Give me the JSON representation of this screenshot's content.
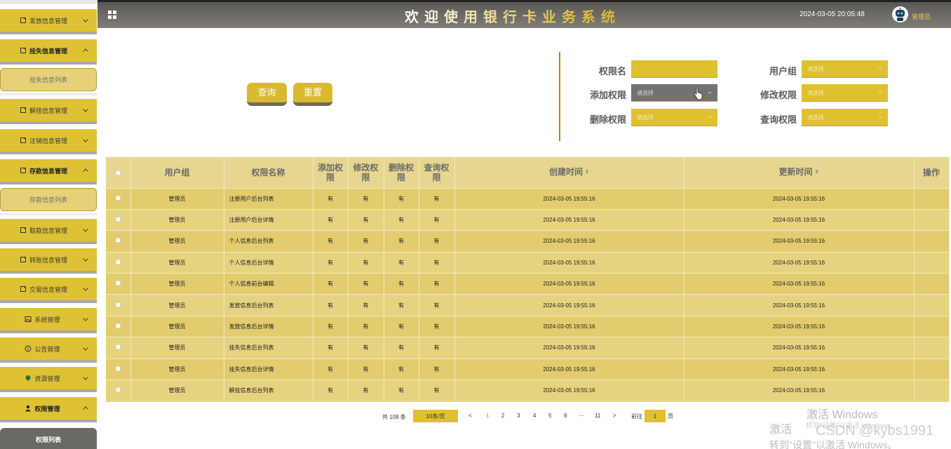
{
  "header": {
    "title": "欢迎使用银行卡业务系统",
    "datetime": "2024-03-05 20:05:48",
    "user": "管理员"
  },
  "sidebar": {
    "items": [
      {
        "label": "发放信息管理",
        "icon": "doc-icon",
        "expanded": false
      },
      {
        "label": "挂失信息管理",
        "icon": "doc-icon",
        "expanded": true,
        "sub": "挂失信息列表"
      },
      {
        "label": "解挂信息管理",
        "icon": "doc-icon",
        "expanded": false
      },
      {
        "label": "注销信息管理",
        "icon": "doc-icon",
        "expanded": false
      },
      {
        "label": "存款信息管理",
        "icon": "doc-icon",
        "expanded": true,
        "sub": "存款信息列表"
      },
      {
        "label": "取款信息管理",
        "icon": "doc-icon",
        "expanded": false
      },
      {
        "label": "转账信息管理",
        "icon": "doc-icon",
        "expanded": false
      },
      {
        "label": "交易信息管理",
        "icon": "doc-icon",
        "expanded": false
      },
      {
        "label": "系统管理",
        "icon": "image-icon",
        "expanded": false
      },
      {
        "label": "公告管理",
        "icon": "info-icon",
        "expanded": false
      },
      {
        "label": "资源管理",
        "icon": "leaf-icon",
        "expanded": false
      },
      {
        "label": "权限管理",
        "icon": "user-icon",
        "expanded": true,
        "sub": "权限列表"
      }
    ]
  },
  "search": {
    "query_label": "查询",
    "reset_label": "重置",
    "fields": {
      "perm_name": {
        "label": "权限名",
        "value": ""
      },
      "user_group": {
        "label": "用户组",
        "placeholder": "请选择"
      },
      "add_perm": {
        "label": "添加权限",
        "placeholder": "请选择"
      },
      "edit_perm": {
        "label": "修改权限",
        "placeholder": "请选择"
      },
      "delete_perm": {
        "label": "删除权限",
        "placeholder": "请选择"
      },
      "query_perm": {
        "label": "查询权限",
        "placeholder": "请选择"
      }
    }
  },
  "table": {
    "headers": {
      "group": "用户组",
      "name": "权限名称",
      "add_1": "添加权",
      "add_2": "限",
      "edit_1": "修改权",
      "edit_2": "限",
      "del_1": "删除权",
      "del_2": "限",
      "query_1": "查询权",
      "query_2": "限",
      "created": "创建时间",
      "updated": "更新时间",
      "ops": "操作"
    },
    "rows": [
      [
        "管理员",
        "注册用户后台列表",
        "有",
        "有",
        "有",
        "有",
        "2024-03-05 19:55:16",
        "2024-03-05 19:55:16"
      ],
      [
        "管理员",
        "注册用户后台详情",
        "有",
        "有",
        "有",
        "有",
        "2024-03-05 19:55:16",
        "2024-03-05 19:55:16"
      ],
      [
        "管理员",
        "个人信息后台列表",
        "有",
        "有",
        "有",
        "有",
        "2024-03-05 19:55:16",
        "2024-03-05 19:55:16"
      ],
      [
        "管理员",
        "个人信息后台详情",
        "有",
        "有",
        "有",
        "有",
        "2024-03-05 19:55:16",
        "2024-03-05 19:55:16"
      ],
      [
        "管理员",
        "个人信息前台编辑",
        "有",
        "有",
        "有",
        "有",
        "2024-03-05 19:55:16",
        "2024-03-05 19:55:16"
      ],
      [
        "管理员",
        "发放信息后台列表",
        "有",
        "有",
        "有",
        "有",
        "2024-03-05 19:55:16",
        "2024-03-05 19:55:16"
      ],
      [
        "管理员",
        "发放信息后台详情",
        "有",
        "有",
        "有",
        "有",
        "2024-03-05 19:55:16",
        "2024-03-05 19:55:16"
      ],
      [
        "管理员",
        "挂失信息后台列表",
        "有",
        "有",
        "有",
        "有",
        "2024-03-05 19:55:16",
        "2024-03-05 19:55:16"
      ],
      [
        "管理员",
        "挂失信息后台详情",
        "有",
        "有",
        "有",
        "有",
        "2024-03-05 19:55:16",
        "2024-03-05 19:55:16"
      ],
      [
        "管理员",
        "解挂信息后台列表",
        "有",
        "有",
        "有",
        "有",
        "2024-03-05 19:55:16",
        "2024-03-05 19:55:16"
      ]
    ]
  },
  "pagination": {
    "total": "共 108 条",
    "page_size": "10条/页",
    "pages": [
      "1",
      "2",
      "3",
      "4",
      "5",
      "6",
      "···",
      "11"
    ],
    "current": "1",
    "prev": "<",
    "next": ">",
    "goto_label": "前往",
    "goto_value": "1",
    "goto_suffix": "页"
  },
  "watermark": {
    "activate": "激活 Windows",
    "line2a": "激活",
    "line2b": "转到\"设置\"以激活 Windows。",
    "csdn": "CSDN @kybs1991",
    "line3": "转到\"设置\"以激活 Windows。"
  },
  "colors": {
    "accent": "#dfc02f",
    "header_bg": "#6b6964",
    "table_bg": "#e6d690"
  }
}
